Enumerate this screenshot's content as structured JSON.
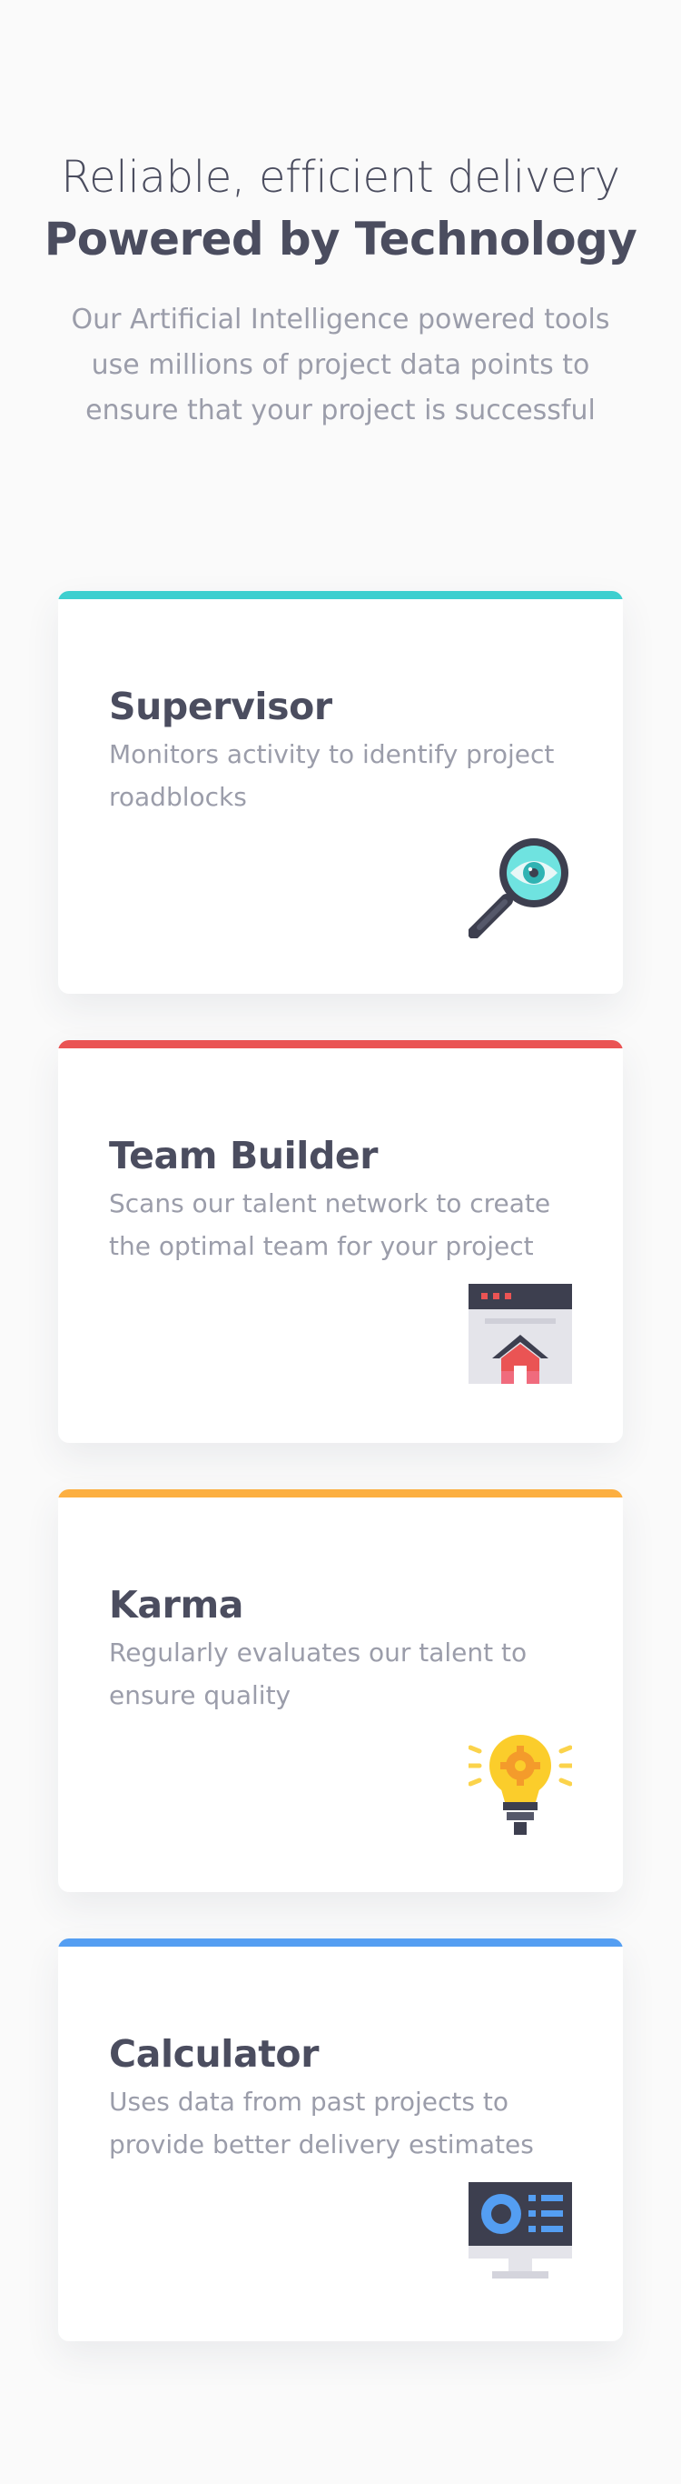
{
  "header": {
    "kicker": "Reliable, efficient delivery",
    "headline": "Powered by Technology",
    "intro": "Our Artificial Intelligence powered tools use millions of project data points to ensure that your project is successful"
  },
  "cards": [
    {
      "title": "Supervisor",
      "description": "Monitors activity to identify project roadblocks",
      "accent": "#3ecfcf",
      "icon": "magnifying-glass-eye-icon"
    },
    {
      "title": "Team Builder",
      "description": "Scans our talent network to create the optimal team for your project",
      "accent": "#ea5454",
      "icon": "browser-home-icon"
    },
    {
      "title": "Karma",
      "description": "Regularly evaluates our talent to ensure quality",
      "accent": "#fcaf41",
      "icon": "light-bulb-gear-icon"
    },
    {
      "title": "Calculator",
      "description": "Uses data from past projects to provide better delivery estimates",
      "accent": "#549ef2",
      "icon": "monitor-dashboard-icon"
    }
  ]
}
